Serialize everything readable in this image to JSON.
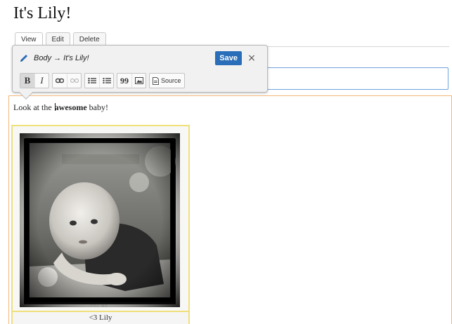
{
  "page": {
    "title": "It's Lily!"
  },
  "tabs": [
    {
      "label": "View"
    },
    {
      "label": "Edit"
    },
    {
      "label": "Delete"
    }
  ],
  "toolbar": {
    "field_path": "Body → It's Lily!",
    "save_label": "Save",
    "close_label": "×",
    "buttons": {
      "bold": "B",
      "italic": "I",
      "blockquote": "99",
      "source": "Source"
    },
    "accent": "#2a6db8"
  },
  "body": {
    "text_before": "Look at the ",
    "text_bold": "awesome",
    "text_after": " baby!"
  },
  "image": {
    "tiny_caption": "YOU  ME",
    "caption": "<3 Lily",
    "subject": "baby photo (black and white)"
  },
  "colors": {
    "body_border": "#f2b77a",
    "figure_border": "#f0e07a",
    "title_field_border": "#6ea4da"
  }
}
